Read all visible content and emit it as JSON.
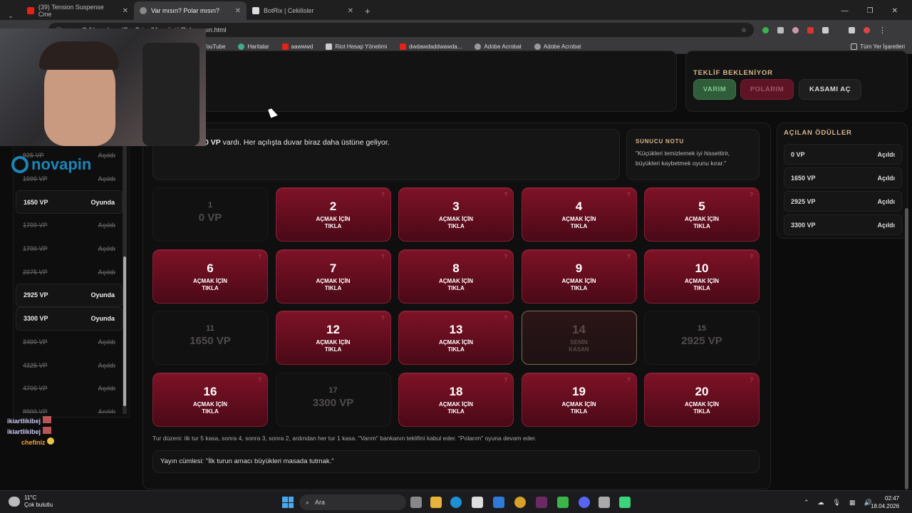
{
  "browser": {
    "tabs": [
      {
        "title": "(39) Tension Suspense Cine",
        "color": "#e62117"
      },
      {
        "title": "Var mısın? Polar mısın?",
        "color": "#888888"
      },
      {
        "title": "BotRix | Cekilisler",
        "color": "#dddddd"
      }
    ],
    "address": "C:/Users/ugur/OneDrive/Masaüstü/Polarmısın.html",
    "bookmarks": [
      "YouTube",
      "Haritalar",
      "aawwwd",
      "Riot Hesap Yönetimi",
      "dwdawdaddwawda...",
      "Adobe Acrobat",
      "Adobe Acrobat"
    ],
    "all_bookmarks": "Tüm Yer İşaretleri"
  },
  "offer": {
    "status": "TEKLİF BEKLENİYOR",
    "varim": "VARIM",
    "polarim": "POLARIM",
    "open_case": "KASAMI AÇ"
  },
  "message": {
    "strong": "0 VP",
    "rest": " vardı. Her açılışta duvar biraz daha üstüne geliyor."
  },
  "note": {
    "title": "SUNUCU NOTU",
    "text": "\"Küçükleri temizlemek iyi hissettirir, büyükleri kaybetmek oyunu kırar.\""
  },
  "boxes": [
    {
      "n": "1",
      "state": "opened",
      "value": "0 VP"
    },
    {
      "n": "2",
      "state": "closed"
    },
    {
      "n": "3",
      "state": "closed"
    },
    {
      "n": "4",
      "state": "closed"
    },
    {
      "n": "5",
      "state": "closed"
    },
    {
      "n": "6",
      "state": "closed"
    },
    {
      "n": "7",
      "state": "closed"
    },
    {
      "n": "8",
      "state": "closed"
    },
    {
      "n": "9",
      "state": "closed"
    },
    {
      "n": "10",
      "state": "closed"
    },
    {
      "n": "11",
      "state": "opened",
      "value": "1650 VP"
    },
    {
      "n": "12",
      "state": "closed"
    },
    {
      "n": "13",
      "state": "closed"
    },
    {
      "n": "14",
      "state": "mine"
    },
    {
      "n": "15",
      "state": "opened",
      "value": "2925 VP"
    },
    {
      "n": "16",
      "state": "closed"
    },
    {
      "n": "17",
      "state": "opened",
      "value": "3300 VP"
    },
    {
      "n": "18",
      "state": "closed"
    },
    {
      "n": "19",
      "state": "closed"
    },
    {
      "n": "20",
      "state": "closed"
    }
  ],
  "box_labels": {
    "closed_line1": "AÇMAK İÇİN",
    "closed_line2": "TIKLA",
    "mine_line1": "SENİN",
    "mine_line2": "KASAN",
    "question": "?"
  },
  "rules_text": "Tur düzeni: ilk tur 5 kasa, sonra 4, sonra 3, sonra 2, ardından her tur 1 kasa. \"Varım\" bankanın teklifini kabul eder. \"Polarım\" oyuna devam eder.",
  "host_line": "Yayın cümlesi: \"İlk turun amacı büyükleri masada tutmak.\"",
  "awards": {
    "title": "AÇILAN ÖDÜLLER",
    "items": [
      {
        "vp": "0 VP",
        "status": "Açıldı"
      },
      {
        "vp": "1650 VP",
        "status": "Açıldı"
      },
      {
        "vp": "2925 VP",
        "status": "Açıldı"
      },
      {
        "vp": "3300 VP",
        "status": "Açıldı"
      }
    ]
  },
  "side_list": [
    {
      "vp": "925 VP",
      "status": "Açıldı",
      "state": "opened"
    },
    {
      "vp": "1000 VP",
      "status": "Açıldı",
      "state": "opened"
    },
    {
      "vp": "1650 VP",
      "status": "Oyunda",
      "state": "active"
    },
    {
      "vp": "1700 VP",
      "status": "Açıldı",
      "state": "opened"
    },
    {
      "vp": "1700 VP",
      "status": "Açıldı",
      "state": "opened"
    },
    {
      "vp": "2075 VP",
      "status": "Açıldı",
      "state": "opened"
    },
    {
      "vp": "2925 VP",
      "status": "Oyunda",
      "state": "active"
    },
    {
      "vp": "3300 VP",
      "status": "Oyunda",
      "state": "active"
    },
    {
      "vp": "3400 VP",
      "status": "Açıldı",
      "state": "opened"
    },
    {
      "vp": "4325 VP",
      "status": "Açıldı",
      "state": "opened"
    },
    {
      "vp": "4700 VP",
      "status": "Açıldı",
      "state": "opened"
    },
    {
      "vp": "8900 VP",
      "status": "Açıldı",
      "state": "opened"
    }
  ],
  "sponsor_logo": "novapin",
  "chat": [
    {
      "user": "ikiartlikibej"
    },
    {
      "user": "ikiartlikibej"
    },
    {
      "user": "chefiniz",
      "color": "#f2a33a"
    }
  ],
  "taskbar": {
    "weather_temp": "11°C",
    "weather_desc": "Çok bulutlu",
    "search": "Ara",
    "time": "02:47",
    "date": "18.04.2026"
  }
}
